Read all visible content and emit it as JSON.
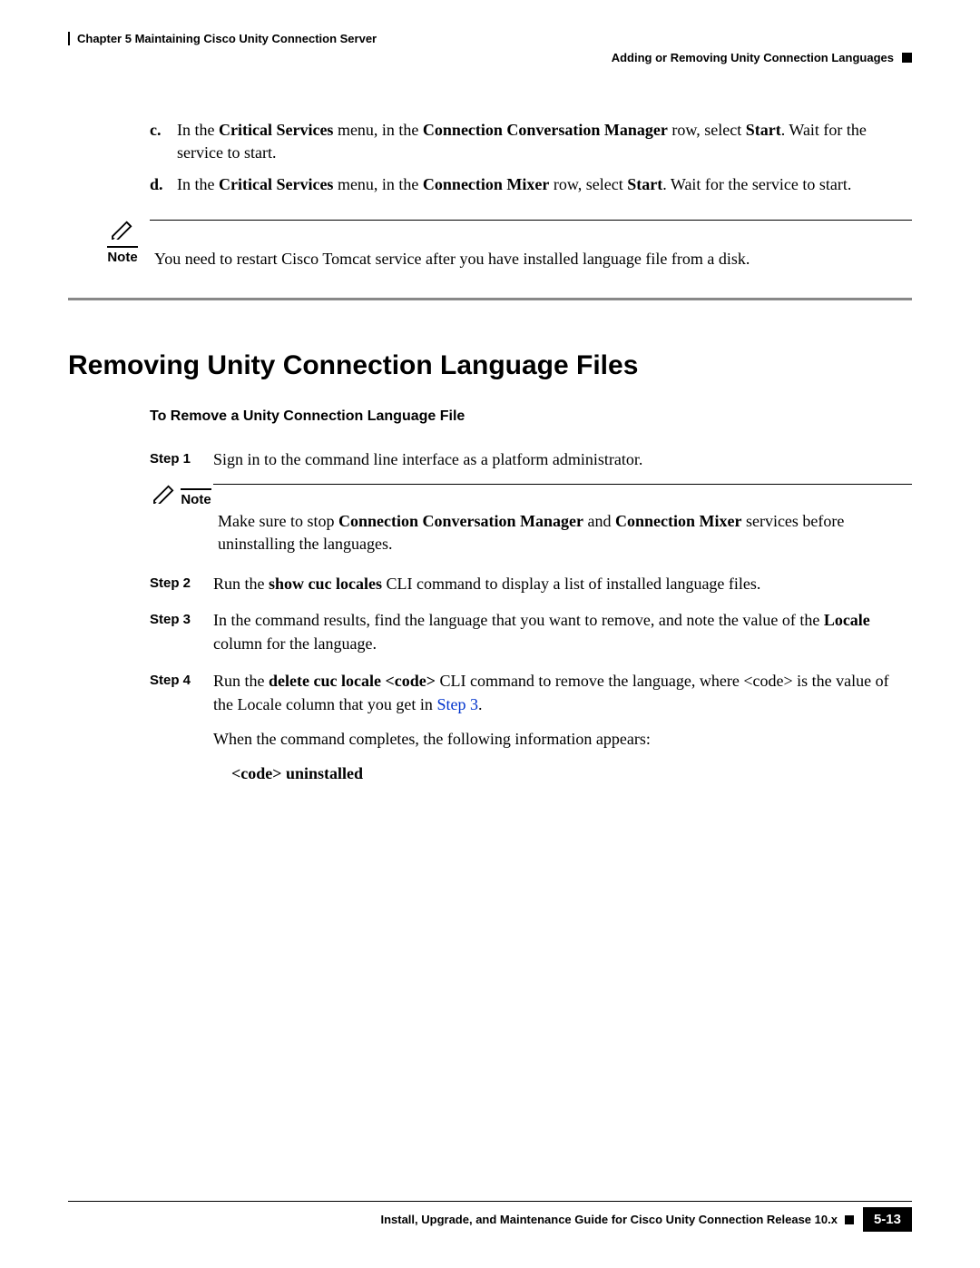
{
  "header": {
    "chapter": "Chapter 5      Maintaining Cisco Unity Connection Server",
    "section": "Adding or Removing Unity Connection Languages"
  },
  "items": {
    "c": {
      "letter": "c.",
      "pre": "In the ",
      "b1": "Critical Services",
      "mid1": " menu, in the ",
      "b2": "Connection Conversation Manager",
      "mid2": " row, select ",
      "b3": "Start",
      "post": ". Wait for the service to start."
    },
    "d": {
      "letter": "d.",
      "pre": "In the ",
      "b1": "Critical Services",
      "mid1": " menu, in the ",
      "b2": "Connection Mixer",
      "mid2": " row, select ",
      "b3": "Start",
      "post": ". Wait for the service to start."
    }
  },
  "note1": {
    "label": "Note",
    "text": "You need to restart Cisco Tomcat service after you have installed language file from a disk."
  },
  "heading": "Removing Unity Connection Language Files",
  "subheading": "To Remove a Unity Connection Language File",
  "steps": {
    "s1": {
      "label": "Step 1",
      "text": "Sign in to the command line interface as a platform administrator."
    },
    "note": {
      "label": "Note",
      "pre": "Make sure to stop ",
      "b1": "Connection Conversation Manager",
      "mid": " and ",
      "b2": "Connection Mixer",
      "post": " services before uninstalling the languages."
    },
    "s2": {
      "label": "Step 2",
      "pre": "Run the ",
      "b1": "show cuc locales",
      "post": " CLI command to display a list of installed language files."
    },
    "s3": {
      "label": "Step 3",
      "pre": "In the command results, find the language that you want to remove, and note the value of the ",
      "b1": "Locale",
      "post": " column for the language."
    },
    "s4": {
      "label": "Step 4",
      "pre": "Run the ",
      "b1": "delete cuc locale <code>",
      "mid": " CLI command to remove the language, where <code> is the value of the Locale column that you get in ",
      "link": "Step 3",
      "post": ".",
      "p2": "When the command completes, the following information appears:",
      "p3": "<code> uninstalled"
    }
  },
  "footer": {
    "title": "Install, Upgrade, and Maintenance Guide for Cisco Unity Connection Release 10.x",
    "page": "5-13"
  }
}
